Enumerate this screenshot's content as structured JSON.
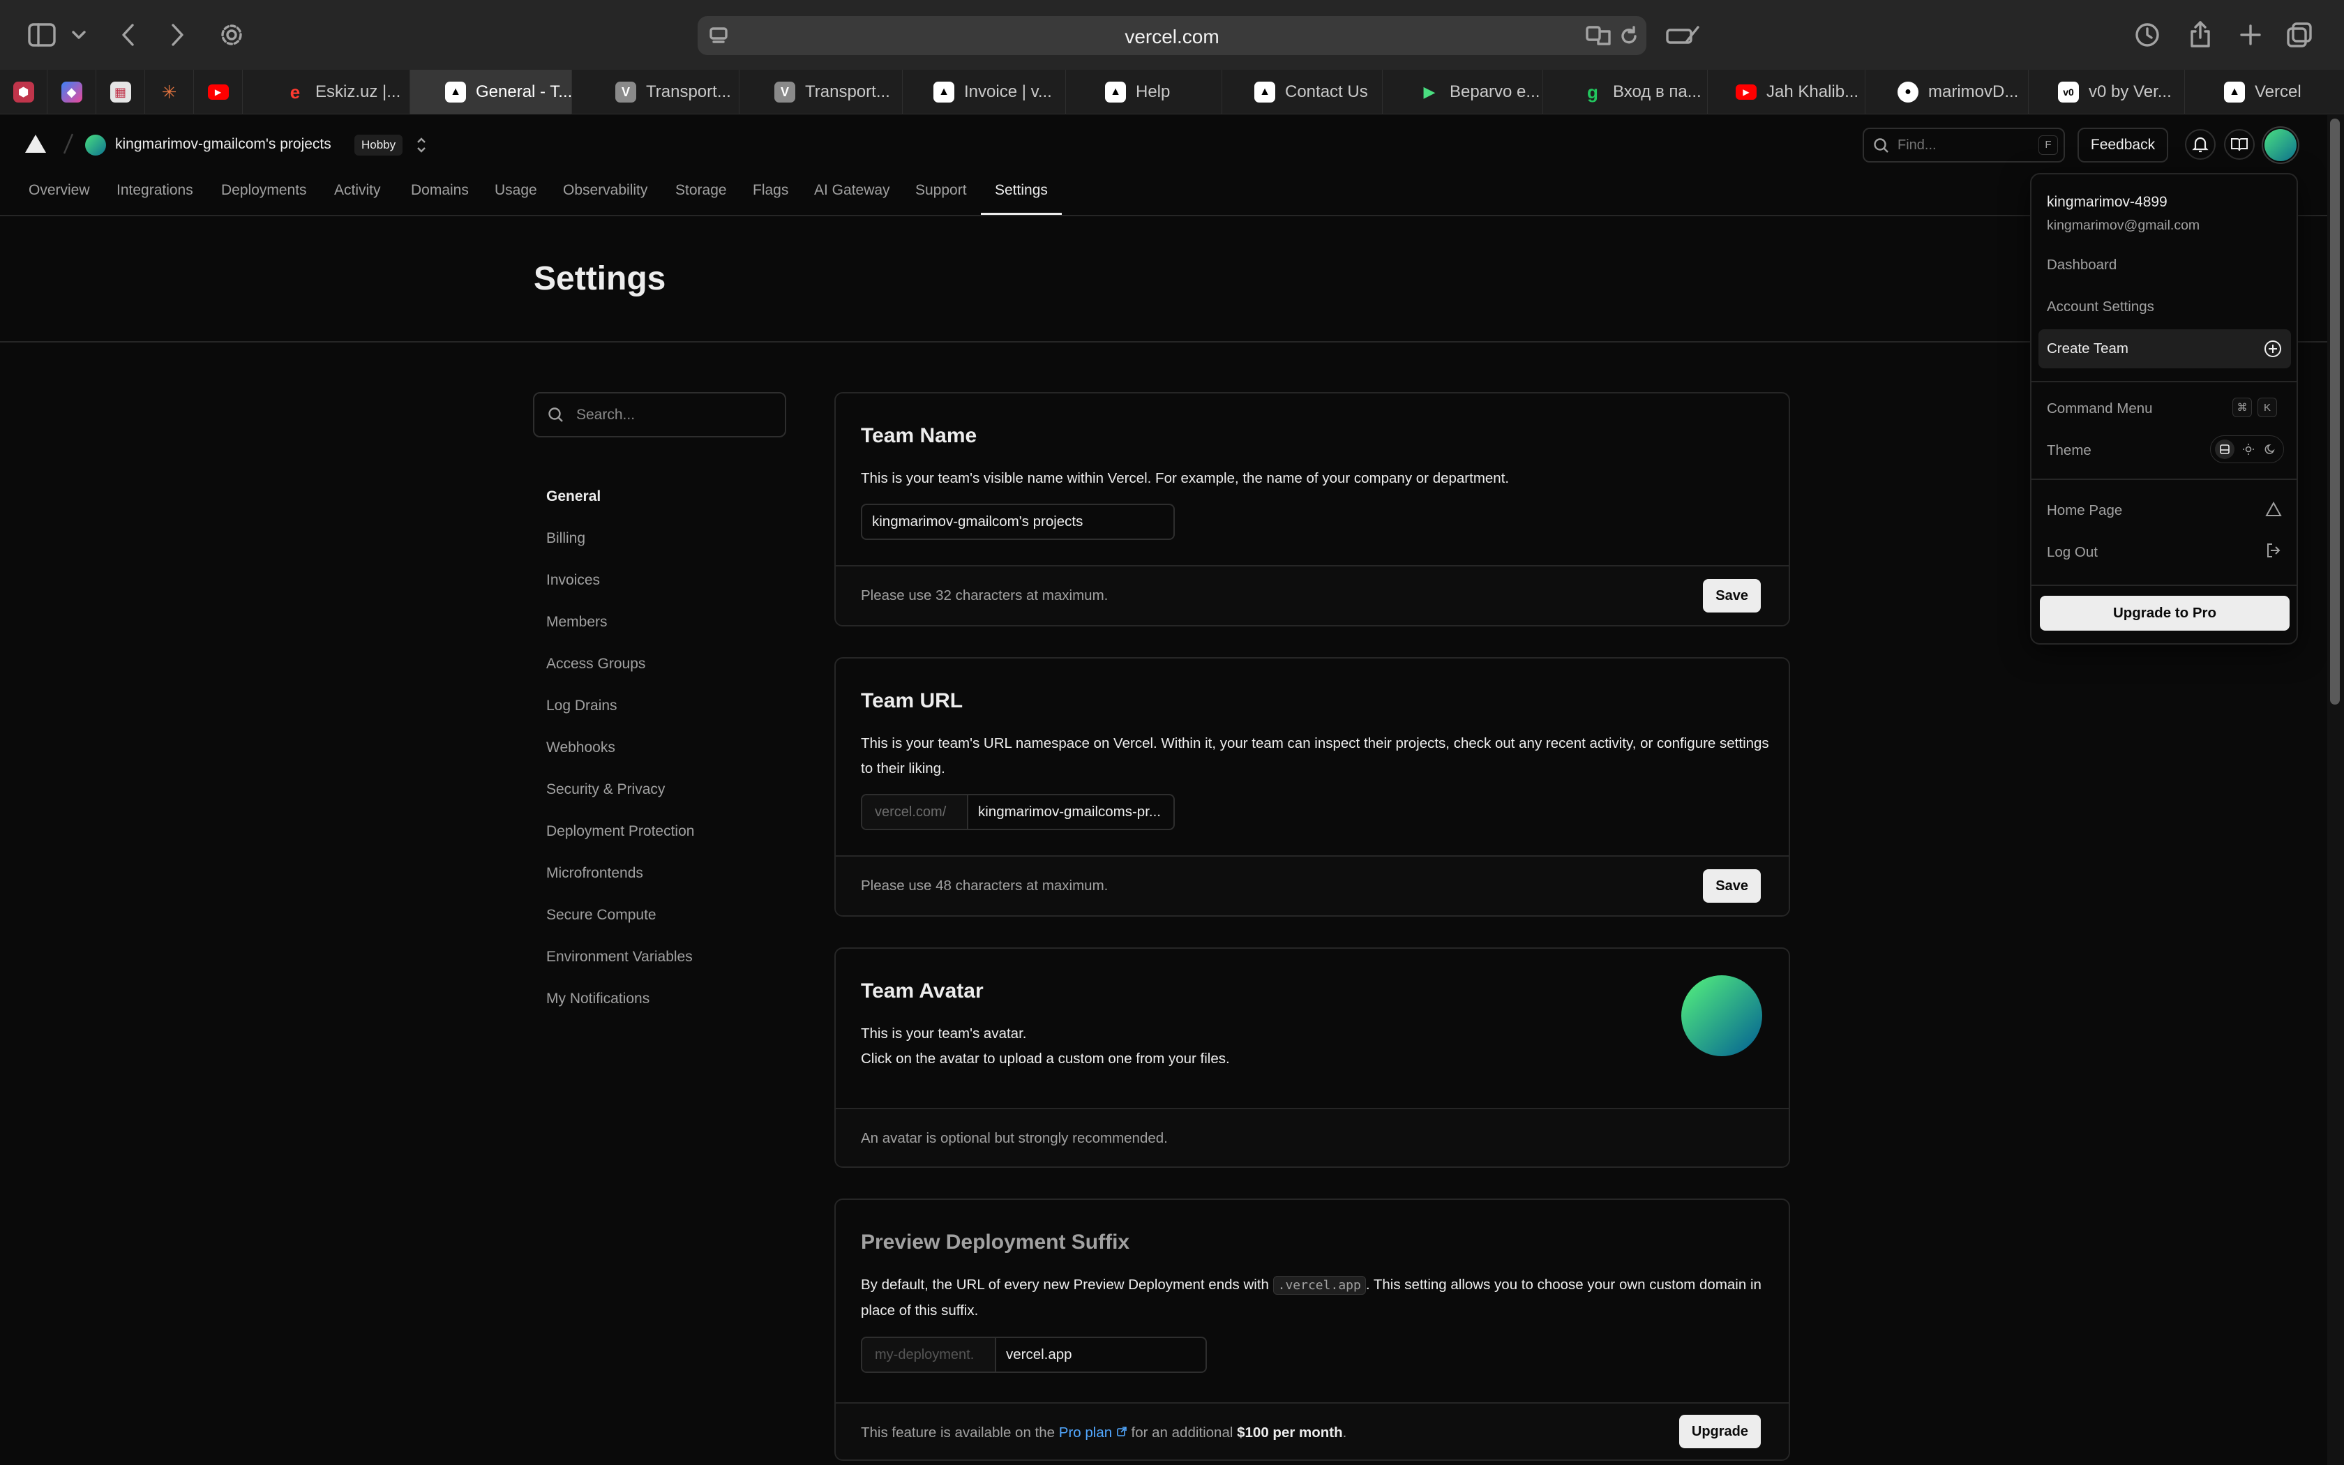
{
  "browser": {
    "url": "vercel.com",
    "tabs": [
      {
        "label": "Eskiz.uz |...",
        "icon": "eskiz-favicon"
      },
      {
        "label": "General - T...",
        "icon": "vercel-favicon",
        "active": true
      },
      {
        "label": "Transport...",
        "icon": "v-favicon"
      },
      {
        "label": "Transport...",
        "icon": "v-favicon"
      },
      {
        "label": "Invoice | v...",
        "icon": "vercel-favicon"
      },
      {
        "label": "Help",
        "icon": "vercel-favicon"
      },
      {
        "label": "Contact Us",
        "icon": "vercel-favicon"
      },
      {
        "label": "Beparvo e...",
        "icon": "play-favicon"
      },
      {
        "label": "Вход в па...",
        "icon": "g-favicon"
      },
      {
        "label": "Jah Khalib...",
        "icon": "youtube-favicon"
      },
      {
        "label": "marimovD...",
        "icon": "github-favicon"
      },
      {
        "label": "v0 by Ver...",
        "icon": "v0-favicon"
      },
      {
        "label": "Vercel",
        "icon": "vercel-favicon"
      }
    ]
  },
  "header": {
    "project_name": "kingmarimov-gmailcom's projects",
    "plan_badge": "Hobby",
    "find_placeholder": "Find...",
    "find_shortcut": "F",
    "feedback_label": "Feedback"
  },
  "nav": {
    "tabs": [
      "Overview",
      "Integrations",
      "Deployments",
      "Activity",
      "Domains",
      "Usage",
      "Observability",
      "Storage",
      "Flags",
      "AI Gateway",
      "Support",
      "Settings"
    ],
    "active": "Settings"
  },
  "page": {
    "title": "Settings",
    "search_placeholder": "Search..."
  },
  "sidebar": {
    "items": [
      "General",
      "Billing",
      "Invoices",
      "Members",
      "Access Groups",
      "Log Drains",
      "Webhooks",
      "Security & Privacy",
      "Deployment Protection",
      "Microfrontends",
      "Secure Compute",
      "Environment Variables",
      "My Notifications"
    ],
    "active": "General"
  },
  "cards": {
    "team_name": {
      "title": "Team Name",
      "description": "This is your team's visible name within Vercel. For example, the name of your company or department.",
      "value": "kingmarimov-gmailcom's projects",
      "note": "Please use 32 characters at maximum.",
      "button": "Save"
    },
    "team_url": {
      "title": "Team URL",
      "description": "This is your team's URL namespace on Vercel. Within it, your team can inspect their projects, check out any recent activity, or configure settings to their liking.",
      "prefix": "vercel.com/",
      "value": "kingmarimov-gmailcoms-pr...",
      "note": "Please use 48 characters at maximum.",
      "button": "Save"
    },
    "team_avatar": {
      "title": "Team Avatar",
      "description_line1": "This is your team's avatar.",
      "description_line2": "Click on the avatar to upload a custom one from your files.",
      "note": "An avatar is optional but strongly recommended."
    },
    "preview_suffix": {
      "title": "Preview Deployment Suffix",
      "description_before": "By default, the URL of every new Preview Deployment ends with",
      "code": ".vercel.app",
      "description_after": ". This setting allows you to choose your own custom domain in place of this suffix.",
      "prefix": "my-deployment.",
      "value": "vercel.app",
      "note_before": "This feature is available on the",
      "note_link": "Pro plan",
      "note_middle": "for an additional",
      "note_price": "$100 per month",
      "note_after": ".",
      "button": "Upgrade"
    }
  },
  "user_menu": {
    "username": "kingmarimov-4899",
    "email": "kingmarimov@gmail.com",
    "items": [
      "Dashboard",
      "Account Settings",
      "Create Team",
      "Command Menu",
      "Theme",
      "Home Page",
      "Log Out"
    ],
    "shortcut_keys": [
      "⌘",
      "K"
    ],
    "upgrade_label": "Upgrade to Pro"
  },
  "colors": {
    "background": "#0a0a0a",
    "border": "#262626",
    "text_primary": "#ededed",
    "text_muted": "#a1a1a1",
    "link": "#52a8ff",
    "avatar_gradient": [
      "#4ade80",
      "#0e7490"
    ]
  }
}
